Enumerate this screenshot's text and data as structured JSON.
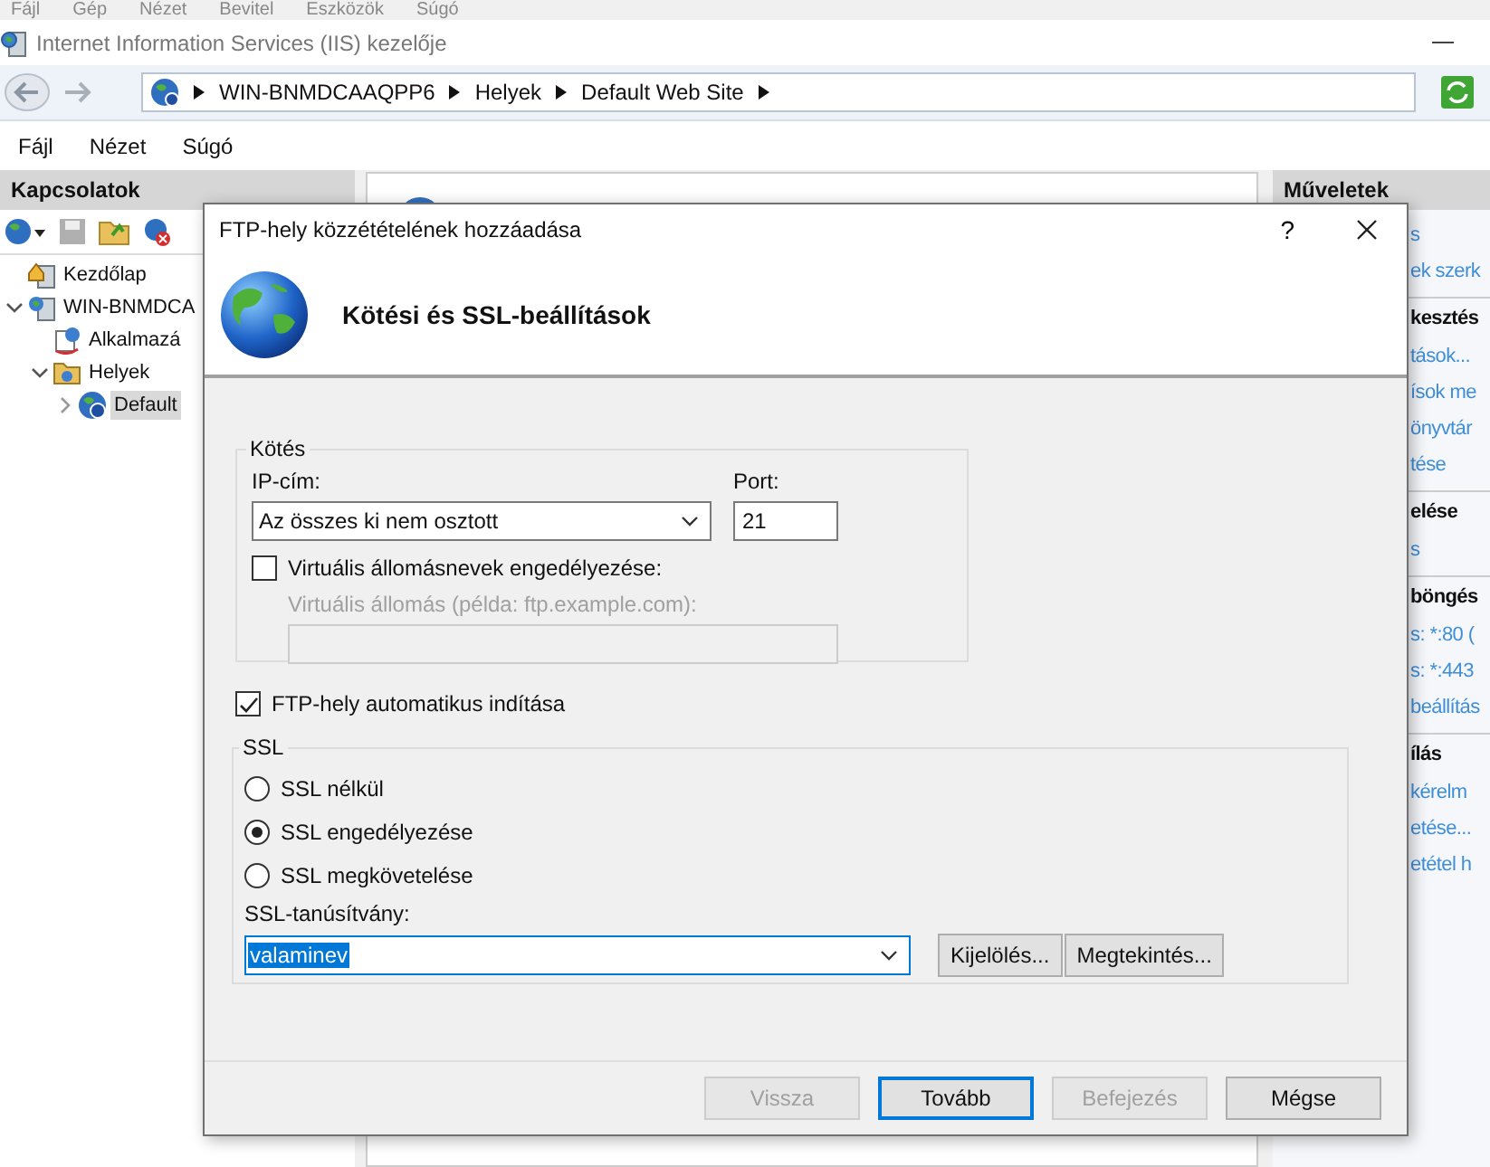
{
  "outer_menu": [
    "Fájl",
    "Gép",
    "Nézet",
    "Bevitel",
    "Eszközök",
    "Súgó"
  ],
  "window": {
    "title": "Internet Information Services (IIS) kezelője"
  },
  "address_bar": {
    "segments": [
      "WIN-BNMDCAAQPP6",
      "Helyek",
      "Default Web Site"
    ]
  },
  "menu": [
    "Fájl",
    "Nézet",
    "Súgó"
  ],
  "connections": {
    "title": "Kapcsolatok",
    "tree": [
      {
        "label": "Kezdőlap",
        "kind": "home",
        "selected": false
      },
      {
        "label": "WIN-BNMDCA",
        "kind": "server",
        "selected": false,
        "expanded": true,
        "children": [
          {
            "label": "Alkalmazá",
            "kind": "apps",
            "selected": false
          },
          {
            "label": "Helyek",
            "kind": "folder",
            "selected": false,
            "expanded": true,
            "children": [
              {
                "label": "Default",
                "kind": "site",
                "selected": true,
                "expanded": false
              }
            ]
          }
        ]
      }
    ]
  },
  "actions": {
    "title": "Műveletek",
    "items": [
      {
        "kind": "link",
        "label": "s"
      },
      {
        "kind": "link",
        "label": "ek szerk"
      },
      {
        "kind": "header",
        "label": "kesztés"
      },
      {
        "kind": "link",
        "label": "tások..."
      },
      {
        "kind": "link",
        "label": "ísok me"
      },
      {
        "kind": "link",
        "label": "önyvtár"
      },
      {
        "kind": "link",
        "label": "tése"
      },
      {
        "kind": "header",
        "label": "elése"
      },
      {
        "kind": "link",
        "label": "s"
      },
      {
        "kind": "header",
        "label": "böngés"
      },
      {
        "kind": "link",
        "label": "s: *:80 ("
      },
      {
        "kind": "link",
        "label": "s: *:443"
      },
      {
        "kind": "link",
        "label": "beállítás"
      },
      {
        "kind": "header",
        "label": "ílás"
      },
      {
        "kind": "link",
        "label": "kérelm"
      },
      {
        "kind": "link",
        "label": "etése..."
      },
      {
        "kind": "link",
        "label": "etétel h"
      }
    ]
  },
  "dialog": {
    "title": "FTP-hely közzétételének hozzáadása",
    "help": "?",
    "heading": "Kötési és SSL-beállítások",
    "binding": {
      "title": "Kötés",
      "ip_label": "IP-cím:",
      "ip_value": "Az összes ki nem osztott",
      "port_label": "Port:",
      "port_value": "21",
      "virtual_host": {
        "label": "Virtuális állomásnevek engedélyezése:",
        "checked": false
      },
      "host_label": "Virtuális állomás (példa: ftp.example.com):"
    },
    "autostart": {
      "label": "FTP-hely automatikus indítása",
      "checked": true
    },
    "ssl": {
      "title": "SSL",
      "options": [
        {
          "label": "SSL nélkül",
          "selected": false
        },
        {
          "label": "SSL engedélyezése",
          "selected": true
        },
        {
          "label": "SSL megkövetelése",
          "selected": false
        }
      ],
      "cert_label": "SSL-tanúsítvány:",
      "cert_value": "valaminev",
      "buttons": [
        "Kijelölés...",
        "Megtekintés..."
      ]
    },
    "buttons": [
      {
        "label": "Vissza",
        "disabled": true,
        "default": false
      },
      {
        "label": "Tovább",
        "disabled": false,
        "default": true
      },
      {
        "label": "Befejezés",
        "disabled": true,
        "default": false
      },
      {
        "label": "Mégse",
        "disabled": false,
        "default": false
      }
    ]
  }
}
